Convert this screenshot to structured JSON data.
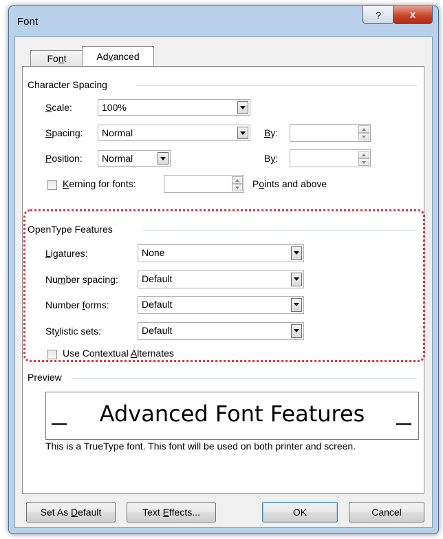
{
  "window": {
    "title": "Font",
    "help_glyph": "?",
    "close_glyph": "x"
  },
  "tabs": [
    {
      "label_pre": "Fo",
      "label_u": "n",
      "label_post": "t"
    },
    {
      "label_pre": "Ad",
      "label_u": "v",
      "label_post": "anced"
    }
  ],
  "character_spacing": {
    "title": "Character Spacing",
    "scale": {
      "label_u": "S",
      "label_post": "cale:",
      "value": "100%"
    },
    "spacing": {
      "label_u": "S",
      "label_post": "pacing:",
      "value": "Normal",
      "by_u": "B",
      "by_post": "y:",
      "by_value": ""
    },
    "position": {
      "label_u": "P",
      "label_post": "osition:",
      "value": "Normal",
      "by_pre": "B",
      "by_u": "y",
      "by_post": ":",
      "by_value": ""
    },
    "kerning": {
      "label_u": "K",
      "label_post": "erning for fonts:",
      "value": "",
      "suffix_pre": "P",
      "suffix_u": "o",
      "suffix_post": "ints and above",
      "checked": false
    }
  },
  "opentype": {
    "title": "OpenType Features",
    "ligatures": {
      "label_u": "L",
      "label_post": "igatures:",
      "value": "None"
    },
    "number_spacing": {
      "label_pre": "Nu",
      "label_u": "m",
      "label_post": "ber spacing:",
      "value": "Default"
    },
    "number_forms": {
      "label_pre": "Number ",
      "label_u": "f",
      "label_post": "orms:",
      "value": "Default"
    },
    "stylistic_sets": {
      "label_pre": "St",
      "label_u": "y",
      "label_post": "listic sets:",
      "value": "Default"
    },
    "contextual": {
      "label_pre": "Use Contextual ",
      "label_u": "A",
      "label_post": "lternates",
      "checked": false
    }
  },
  "preview": {
    "title": "Preview",
    "sample": "Advanced Font Features",
    "note": "This is a TrueType font. This font will be used on both printer and screen."
  },
  "buttons": {
    "set_default": {
      "pre": "Set As ",
      "u": "D",
      "post": "efault"
    },
    "text_effects": {
      "pre": "Text ",
      "u": "E",
      "post": "ffects..."
    },
    "ok": "OK",
    "cancel": "Cancel"
  },
  "colors": {
    "highlight": "#e8303a",
    "titlebar": "#b9d1ea",
    "close": "#c9432c"
  }
}
